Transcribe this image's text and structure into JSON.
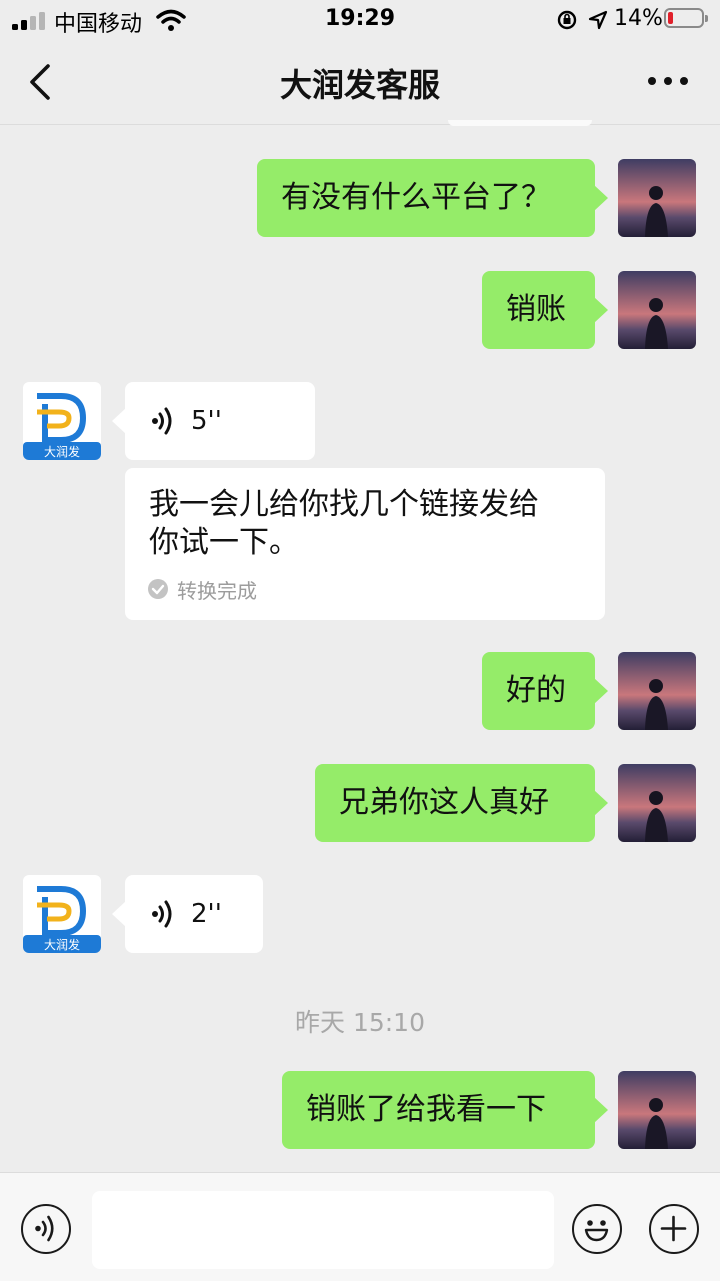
{
  "status_bar": {
    "carrier": "中国移动",
    "time": "19:29",
    "battery": "14%",
    "battery_color": "#e0202b"
  },
  "header": {
    "title": "大润发客服",
    "back_icon": "chevron-left-icon",
    "more_icon": "more-dots-icon"
  },
  "avatars": {
    "cs_logo_text": "大润发",
    "cs_logo_colors": [
      "#1e7ad6",
      "#f2b21b"
    ]
  },
  "messages": [
    {
      "from": "me",
      "type": "text",
      "text": "有没有什么平台了？"
    },
    {
      "from": "me",
      "type": "text",
      "text": "销账"
    },
    {
      "from": "service",
      "type": "voice",
      "duration": "5''"
    },
    {
      "from": "service",
      "type": "transcript",
      "text_line1": "我一会儿给你找几个链接发给",
      "text_line2": "你试一下。",
      "status": "转换完成"
    },
    {
      "from": "me",
      "type": "text",
      "text": "好的"
    },
    {
      "from": "me",
      "type": "text",
      "text": "兄弟你这人真好"
    },
    {
      "from": "service",
      "type": "voice",
      "duration": "2''"
    },
    {
      "from": "me",
      "type": "text",
      "text": "销账了给我看一下"
    }
  ],
  "timestamp": "昨天 15:10",
  "input_bar": {
    "voice_icon": "voice-input-icon",
    "emoji_icon": "emoji-icon",
    "plus_icon": "plus-icon",
    "placeholder": ""
  },
  "colors": {
    "background": "#ededed",
    "my_bubble": "#95ec69",
    "their_bubble": "#ffffff"
  }
}
